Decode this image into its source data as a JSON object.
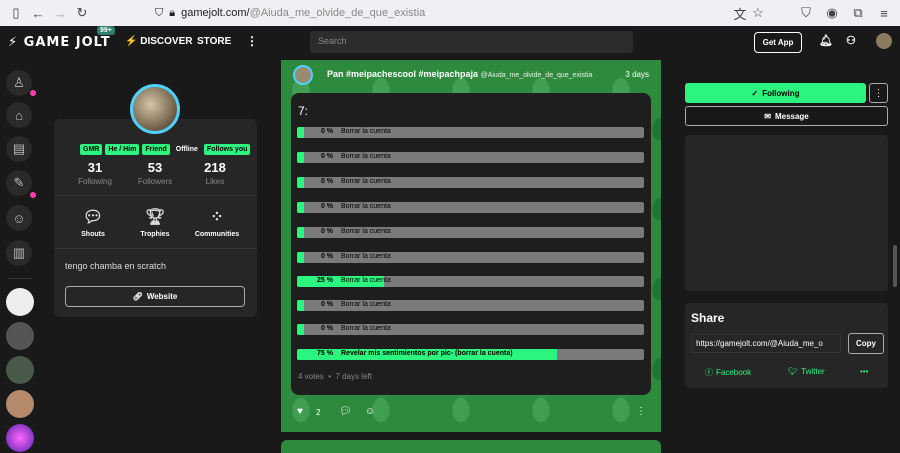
{
  "browser": {
    "url_host": "gamejolt.com/",
    "url_path": "@Aiuda_me_olvide_de_que_existia"
  },
  "nav": {
    "logo": "GAME JOLT",
    "notif_badge": "99+",
    "discover": "DISCOVER",
    "store": "STORE",
    "search_placeholder": "Search",
    "get_app": "Get App"
  },
  "profile": {
    "tags": [
      "GMR",
      "He / Him",
      "Friend",
      "Offline",
      "Follows you"
    ],
    "following_count": "31",
    "following_label": "Following",
    "followers_count": "53",
    "followers_label": "Followers",
    "likes_count": "218",
    "likes_label": "Likes",
    "shouts": "Shouts",
    "trophies": "Trophies",
    "communities": "Communities",
    "bio": "tengo chamba en scratch",
    "website": "Website"
  },
  "post": {
    "title": "Pan #meipachescool #meipachpaja",
    "user": "@Aiuda_me_olvide_de_que_existia",
    "time": "3 days",
    "question": "7:",
    "options": [
      {
        "pct": "0 %",
        "fill": 0.02,
        "label": "Borrar la cuenta"
      },
      {
        "pct": "0 %",
        "fill": 0.02,
        "label": "Borrar la cuenta"
      },
      {
        "pct": "0 %",
        "fill": 0.02,
        "label": "Borrar la cuenta"
      },
      {
        "pct": "0 %",
        "fill": 0.02,
        "label": "Borrar la cuenta"
      },
      {
        "pct": "0 %",
        "fill": 0.02,
        "label": "Borrar la cuenta"
      },
      {
        "pct": "0 %",
        "fill": 0.02,
        "label": "Borrar la cuenta"
      },
      {
        "pct": "25 %",
        "fill": 0.25,
        "label": "Borrar la cuenta"
      },
      {
        "pct": "0 %",
        "fill": 0.02,
        "label": "Borrar la cuenta"
      },
      {
        "pct": "0 %",
        "fill": 0.02,
        "label": "Borrar la cuenta"
      },
      {
        "pct": "75 %",
        "fill": 0.75,
        "label": "Revelar mis sentimientos por pic- (borrar la cuenta)"
      }
    ],
    "votes": "4 votes",
    "days_left": "7 days left",
    "likes": "2"
  },
  "right": {
    "following": "Following",
    "message": "Message",
    "share_title": "Share",
    "share_url": "https://gamejolt.com/@Aiuda_me_o",
    "copy": "Copy",
    "facebook": "Facebook",
    "twitter": "Twitter",
    "more": "•••"
  },
  "colors": {
    "accent": "#2bf57e",
    "notif": "#ff3fac"
  }
}
